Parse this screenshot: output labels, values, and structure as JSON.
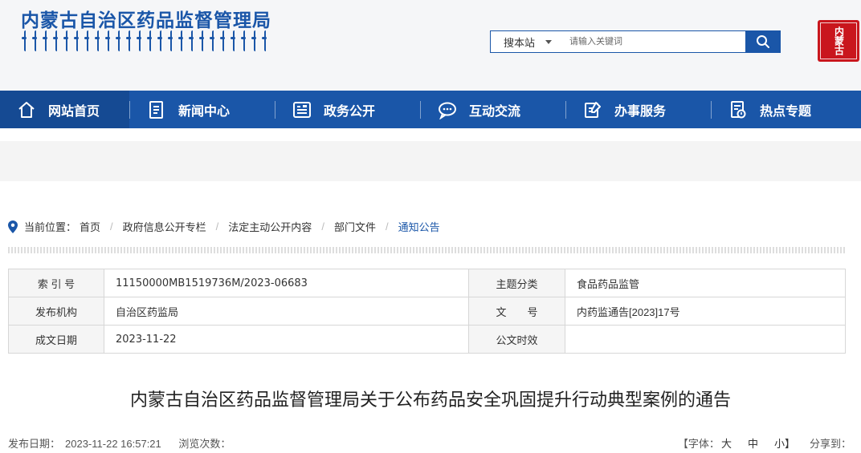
{
  "header": {
    "site_title": "内蒙古自治区药品监督管理局",
    "search_scope": "搜本站",
    "search_placeholder": "请输入关键词",
    "seal_text": "内蒙古"
  },
  "nav": {
    "items": [
      {
        "label": "网站首页",
        "icon": "home-icon"
      },
      {
        "label": "新闻中心",
        "icon": "news-icon"
      },
      {
        "label": "政务公开",
        "icon": "gov-info-icon"
      },
      {
        "label": "互动交流",
        "icon": "chat-icon"
      },
      {
        "label": "办事服务",
        "icon": "service-icon"
      },
      {
        "label": "热点专题",
        "icon": "topic-icon"
      }
    ],
    "active_index": 0
  },
  "breadcrumb": {
    "prefix": "当前位置：",
    "items": [
      "首页",
      "政府信息公开专栏",
      "法定主动公开内容",
      "部门文件",
      "通知公告"
    ]
  },
  "meta": {
    "index_label": "索 引 号",
    "index_value": "11150000MB1519736M/2023-06683",
    "topic_label": "主题分类",
    "topic_value": "食品药品监管",
    "issuer_label": "发布机构",
    "issuer_value": "自治区药监局",
    "docno_label": "文　　号",
    "docno_value": "内药监通告[2023]17号",
    "date_label": "成文日期",
    "date_value": "2023-11-22",
    "validity_label": "公文时效",
    "validity_value": ""
  },
  "article": {
    "title": "内蒙古自治区药品监督管理局关于公布药品安全巩固提升行动典型案例的通告",
    "publish_label": "发布日期：",
    "publish_value": "2023-11-22 16:57:21",
    "views_label": "浏览次数：",
    "font_label": "【字体：",
    "font_large": "大",
    "font_medium": "中",
    "font_small": "小】",
    "share_label": "分享到："
  },
  "colors": {
    "brand_blue": "#1a56a8",
    "nav_active": "#154a93",
    "seal_red": "#c9161d"
  }
}
